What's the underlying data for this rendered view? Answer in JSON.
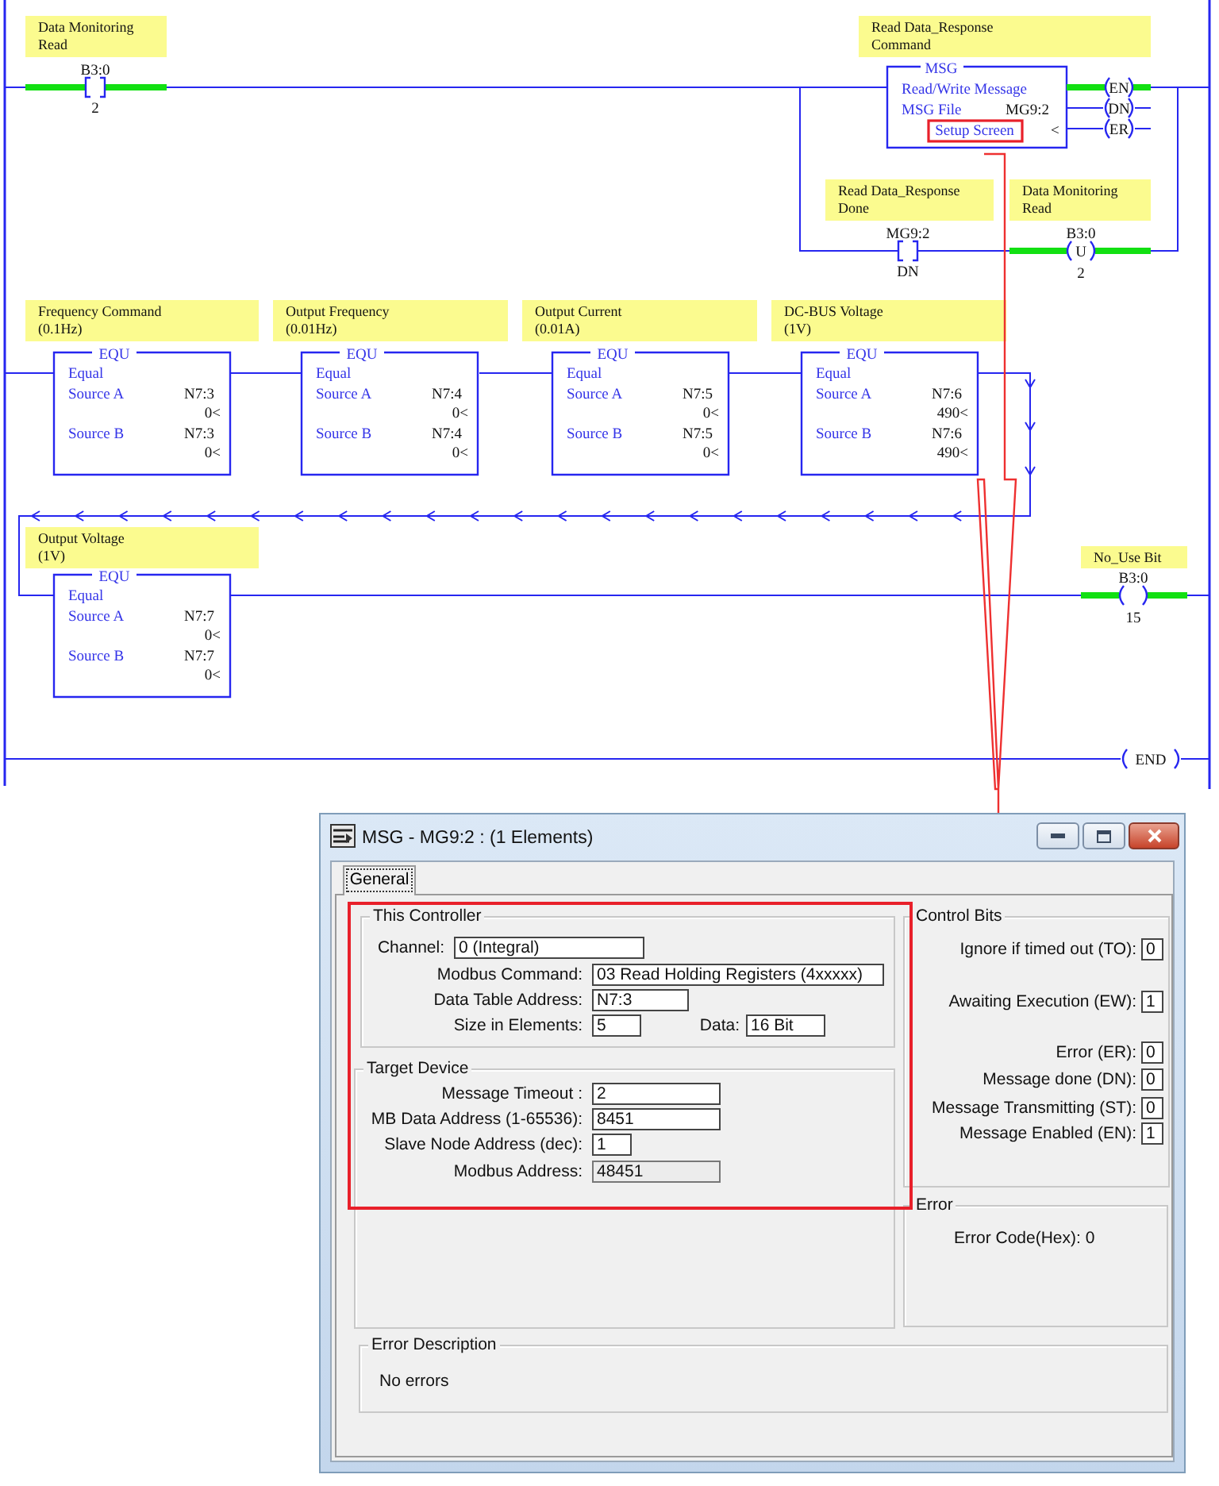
{
  "ladder": {
    "rungs": [
      {
        "instructions": [
          {
            "kind": "contact",
            "comment": [
              "Data Monitoring",
              "Read"
            ],
            "address": "B3:0",
            "bit": "2",
            "energized": true
          },
          {
            "kind": "msg",
            "comment": [
              "Read Data_Response",
              "Command"
            ],
            "title": "MSG",
            "label": "Read/Write Message",
            "file_label": "MSG File",
            "file": "MG9:2",
            "setup": "Setup Screen",
            "more": "<",
            "outputs": [
              {
                "label": "EN",
                "energized": true
              },
              {
                "label": "DN",
                "energized": false
              },
              {
                "label": "ER",
                "energized": false
              }
            ]
          }
        ],
        "branch": [
          {
            "kind": "contact",
            "comment": [
              "Read Data_Response",
              "Done"
            ],
            "address": "MG9:2",
            "bit": "DN",
            "energized": false
          },
          {
            "kind": "unlatch",
            "comment": [
              "Data Monitoring",
              "Read"
            ],
            "address": "B3:0",
            "bit": "2",
            "symbol": "U",
            "energized": true
          }
        ]
      },
      {
        "instructions": [
          {
            "kind": "equ",
            "comment": [
              "Frequency Command",
              "(0.1Hz)"
            ],
            "title": "EQU",
            "label": "Equal",
            "source_a": {
              "label": "Source A",
              "address": "N7:3",
              "value": "0<"
            },
            "source_b": {
              "label": "Source B",
              "address": "N7:3",
              "value": "0<"
            }
          },
          {
            "kind": "equ",
            "comment": [
              "Output Frequency",
              "(0.01Hz)"
            ],
            "title": "EQU",
            "label": "Equal",
            "source_a": {
              "label": "Source A",
              "address": "N7:4",
              "value": "0<"
            },
            "source_b": {
              "label": "Source B",
              "address": "N7:4",
              "value": "0<"
            }
          },
          {
            "kind": "equ",
            "comment": [
              "Output Current",
              "(0.01A)"
            ],
            "title": "EQU",
            "label": "Equal",
            "source_a": {
              "label": "Source A",
              "address": "N7:5",
              "value": "0<"
            },
            "source_b": {
              "label": "Source B",
              "address": "N7:5",
              "value": "0<"
            }
          },
          {
            "kind": "equ",
            "comment": [
              "DC-BUS Voltage",
              "(1V)"
            ],
            "title": "EQU",
            "label": "Equal",
            "source_a": {
              "label": "Source A",
              "address": "N7:6",
              "value": "490<"
            },
            "source_b": {
              "label": "Source B",
              "address": "N7:6",
              "value": "490<"
            }
          }
        ]
      },
      {
        "instructions": [
          {
            "kind": "equ",
            "comment": [
              "Output Voltage",
              "(1V)"
            ],
            "title": "EQU",
            "label": "Equal",
            "source_a": {
              "label": "Source A",
              "address": "N7:7",
              "value": "0<"
            },
            "source_b": {
              "label": "Source B",
              "address": "N7:7",
              "value": "0<"
            }
          },
          {
            "kind": "coil",
            "comment": [
              "No_Use Bit"
            ],
            "address": "B3:0",
            "bit": "15",
            "energized": true
          }
        ]
      },
      {
        "instructions": [
          {
            "kind": "end",
            "label": "END"
          }
        ]
      }
    ]
  },
  "dialog": {
    "title": "MSG - MG9:2 : (1 Elements)",
    "tabs": [
      {
        "label": "General",
        "selected": true
      }
    ],
    "this_controller": {
      "title": "This Controller",
      "fields": [
        {
          "label": "Channel:",
          "value": "0 (Integral)",
          "read_only": false
        },
        {
          "label": "Modbus Command:",
          "value": "03 Read Holding Registers (4xxxxx)",
          "read_only": false
        },
        {
          "label": "Data Table Address:",
          "value": "N7:3",
          "read_only": false
        },
        {
          "label": "Size in Elements:",
          "value": "5",
          "read_only": false
        }
      ],
      "data": {
        "label": "Data:",
        "value": "16 Bit",
        "read_only": false
      }
    },
    "target_device": {
      "title": "Target Device",
      "fields": [
        {
          "label": "Message Timeout :",
          "value": "2",
          "read_only": false
        },
        {
          "label": "MB Data Address (1-65536):",
          "value": "8451",
          "read_only": false
        },
        {
          "label": "Slave Node Address (dec):",
          "value": "1",
          "read_only": false
        },
        {
          "label": "Modbus Address:",
          "value": "48451",
          "read_only": true
        }
      ]
    },
    "control_bits": {
      "title": "Control Bits",
      "bits": [
        {
          "label": "Ignore if timed out (TO):",
          "value": "0"
        },
        {
          "label": "Awaiting Execution (EW):",
          "value": "1"
        },
        {
          "label": "Error (ER):",
          "value": "0"
        },
        {
          "label": "Message done (DN):",
          "value": "0"
        },
        {
          "label": "Message Transmitting (ST):",
          "value": "0"
        },
        {
          "label": "Message Enabled (EN):",
          "value": "1"
        }
      ]
    },
    "error": {
      "title": "Error",
      "text": "Error Code(Hex): 0"
    },
    "error_description": {
      "title": "Error Description",
      "text": "No errors"
    }
  }
}
